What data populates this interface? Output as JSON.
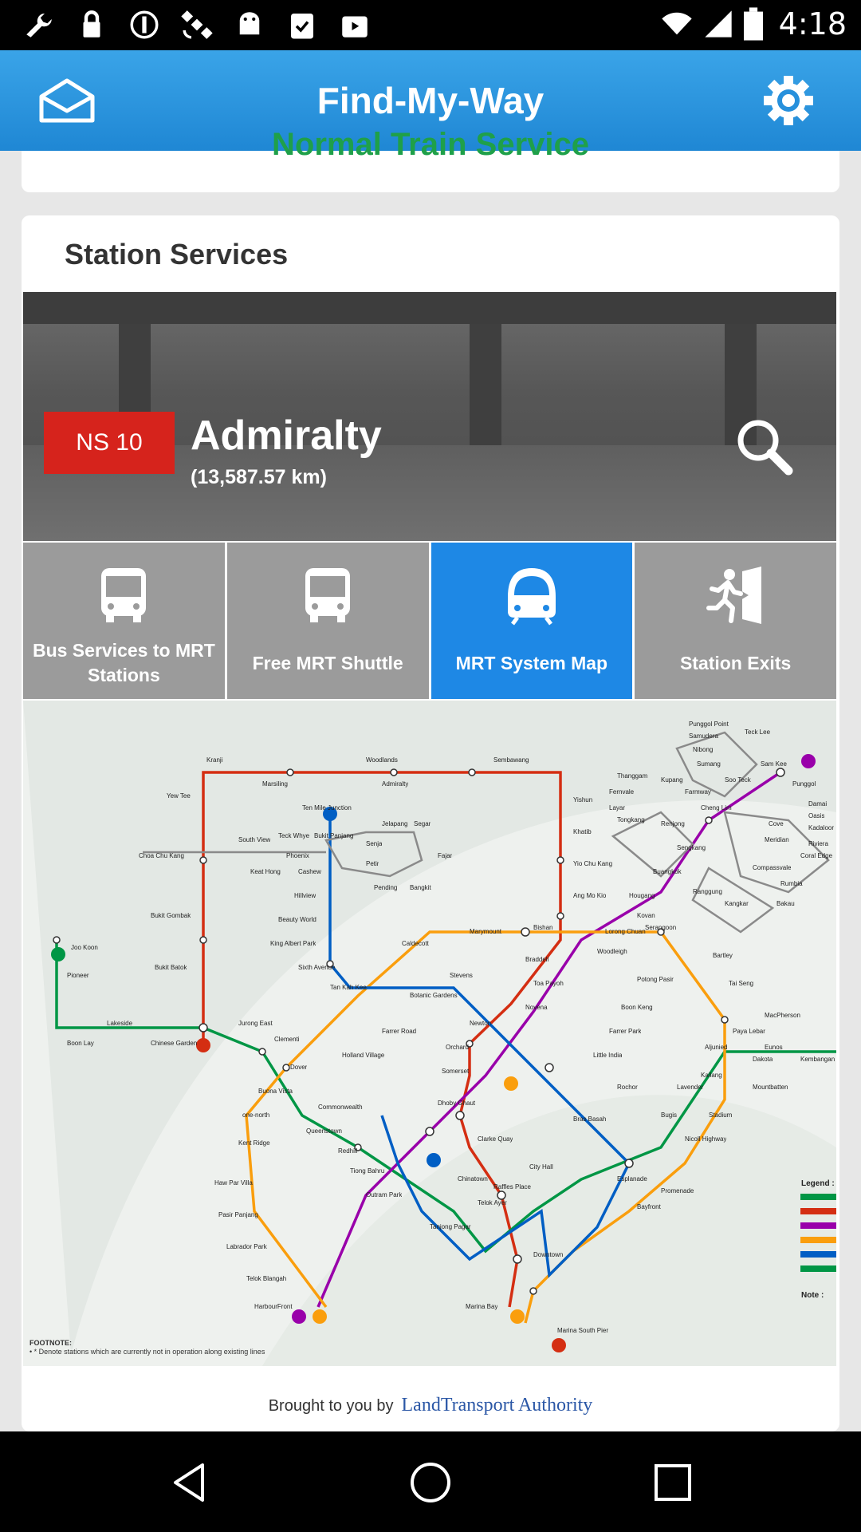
{
  "status_bar": {
    "time": "4:18",
    "icons": [
      "wrench-icon",
      "lock-icon",
      "info-icon",
      "satellite-icon",
      "android-icon",
      "clipboard-check-icon",
      "play-store-icon",
      "wifi-icon",
      "signal-icon",
      "battery-icon"
    ]
  },
  "app_bar": {
    "title": "Find-My-Way",
    "left_icon": "inbox-icon",
    "right_icon": "gear-icon"
  },
  "partial_card": {
    "text": "Normal Train Service"
  },
  "station_services": {
    "heading": "Station Services",
    "station_code": "NS 10",
    "station_name": "Admiralty",
    "distance": "(13,587.57 km)",
    "tiles": [
      {
        "label": "Bus Services to MRT Stations",
        "icon": "bus-icon",
        "active": false
      },
      {
        "label": "Free MRT Shuttle",
        "icon": "bus-icon",
        "active": false
      },
      {
        "label": "MRT System Map",
        "icon": "train-icon",
        "active": true
      },
      {
        "label": "Station Exits",
        "icon": "exit-icon",
        "active": false
      }
    ]
  },
  "map": {
    "footnote_title": "FOOTNOTE:",
    "footnote_text": "• * Denote stations which are currently not in operation along existing lines",
    "legend_title": "Legend :",
    "note_title": "Note :",
    "stations": [
      "Kranji",
      "Woodlands",
      "Sembawang",
      "Marsiling",
      "Admiralty",
      "Yew Tee",
      "Yishun",
      "Khatib",
      "Yio Chu Kang",
      "Ang Mo Kio",
      "Bishan",
      "Braddell",
      "Toa Payoh",
      "Novena",
      "Newton",
      "Orchard",
      "Somerset",
      "Dhoby Ghaut",
      "City Hall",
      "Raffles Place",
      "Marina Bay",
      "Marina South Pier",
      "Jurong East",
      "Joo Koon",
      "Pioneer",
      "Boon Lay",
      "Lakeside",
      "Chinese Garden",
      "Clementi",
      "Dover",
      "Buona Vista",
      "Commonwealth",
      "Queenstown",
      "Redhill",
      "Tiong Bahru",
      "Outram Park",
      "Tanjong Pagar",
      "Bukit Panjang",
      "Bukit Batok",
      "Bukit Gombak",
      "Choa Chu Kang",
      "Cashew",
      "Hillview",
      "Beauty World",
      "King Albert Park",
      "Sixth Avenue",
      "Tan Kah Kee",
      "Botanic Gardens",
      "Stevens",
      "Caldecott",
      "Marymount",
      "Lorong Chuan",
      "Serangoon",
      "Woodleigh",
      "Potong Pasir",
      "Boon Keng",
      "Farrer Park",
      "Little India",
      "Rochor",
      "Bugis",
      "Chinatown",
      "Clarke Quay",
      "Telok Ayer",
      "Downtown",
      "Bayfront",
      "Promenade",
      "Esplanade",
      "Bras Basah",
      "Nicoll Highway",
      "Stadium",
      "Mountbatten",
      "Dakota",
      "Paya Lebar",
      "Aljunied",
      "Kallang",
      "Lavender",
      "MacPherson",
      "Tai Seng",
      "Bartley",
      "Eunos",
      "Kembangan",
      "Punggol",
      "Sengkang",
      "Buangkok",
      "Hougang",
      "Kovan",
      "HarbourFront",
      "Telok Blangah",
      "Labrador Park",
      "Pasir Panjang",
      "Haw Par Villa",
      "Kent Ridge",
      "one-north",
      "Holland Village",
      "Farrer Road",
      "Holland Village",
      "Punggol Point",
      "Samudera",
      "Teck Lee",
      "Nibong",
      "Sumang",
      "Soo Teck",
      "Sam Kee",
      "Damai",
      "Oasis",
      "Kadaloor",
      "Riviera",
      "Coral Edge",
      "Meridian",
      "Cove",
      "Compassvale",
      "Rumbia",
      "Bakau",
      "Kangkar",
      "Ranggung",
      "Renjong",
      "Cheng Lim",
      "Farmway",
      "Kupang",
      "Thanggam",
      "Fernvale",
      "Layar",
      "Tongkang",
      "Senja",
      "Jelapang",
      "Segar",
      "Fajar",
      "Bangkit",
      "Pending",
      "Petir",
      "Phoenix",
      "Keat Hong",
      "Teck Whye",
      "South View",
      "Ten Mile Junction"
    ]
  },
  "credit": {
    "prefix": "Brought to you by",
    "authority": "LandTransport Authority"
  },
  "colors": {
    "app_bar": "#1f87d4",
    "badge": "#d6231c",
    "tile_active": "#1e88e5",
    "tile_inactive": "#9b9b9b",
    "ns_line": "#d42e12",
    "ew_line": "#009645",
    "ne_line": "#9900aa",
    "cc_line": "#fa9e0d",
    "dt_line": "#005ec4"
  }
}
